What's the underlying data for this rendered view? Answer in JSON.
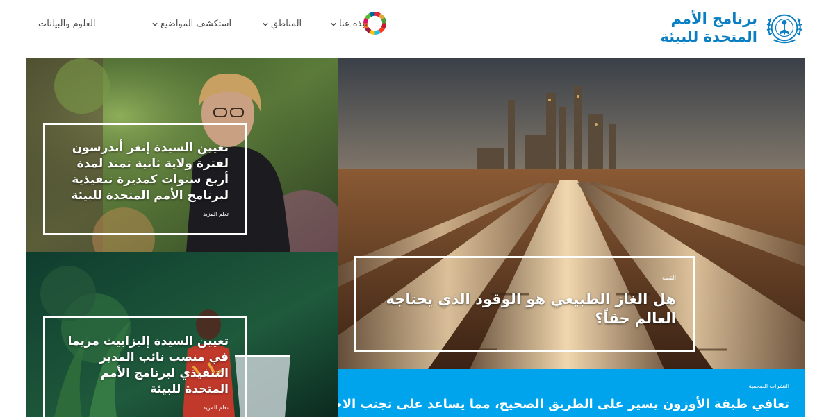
{
  "header": {
    "logo_line1": "برنامج الأمم",
    "logo_line2": "المتحدة للبيئة",
    "nav": [
      {
        "label": "نبذة عنا",
        "has_dropdown": true
      },
      {
        "label": "المناطق",
        "has_dropdown": true
      },
      {
        "label": "استكشف المواضيع",
        "has_dropdown": true
      },
      {
        "label": "العلوم والبيانات",
        "has_dropdown": false
      }
    ],
    "brand_color": "#0a7ec2"
  },
  "tiles": {
    "top_left": {
      "title": "تعيين السيدة إنغر أندرسون لفترة ولاية ثانية تمتد لمدة أربع سنوات كمديرة تنفيذية لبرنامج الأمم المتحدة للبيئة",
      "cta": "تعلم المزيد"
    },
    "bottom_left": {
      "title": "تعيين السيدة إليزابيث مريما في منصب نائب المدير التنفيذي لبرنامج الأمم المتحدة للبيئة",
      "cta": "تعلم المزيد"
    },
    "feature": {
      "tag": "القصة",
      "title": "هل الغاز الطبيعي هو الوقود الذي يحتاجه العالم حقاً؟"
    },
    "press": {
      "tag": "النشرات الصحفية",
      "title": "تعافي طبقة الأوزون يسير على الطريق الصحيح، مما يساعد على تجنب الاحترار",
      "bg_color": "#00a4ec"
    }
  }
}
